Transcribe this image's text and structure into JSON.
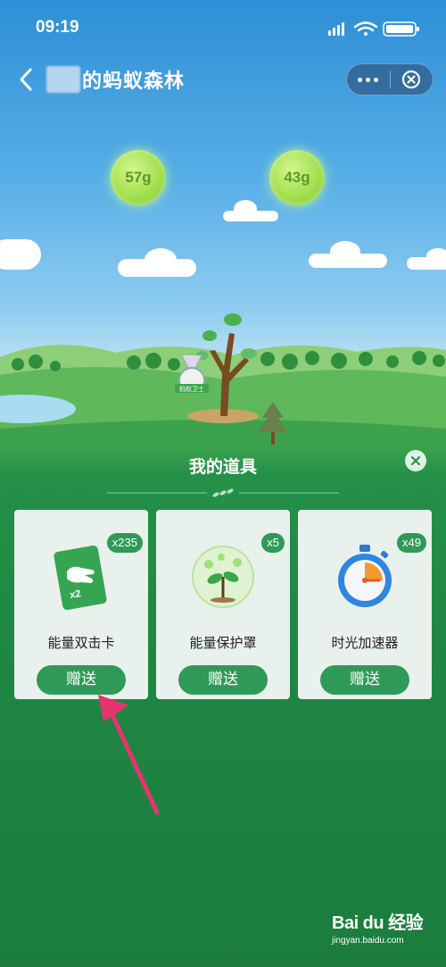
{
  "status_bar": {
    "time": "09:19"
  },
  "nav": {
    "title": "的蚂蚁森林"
  },
  "energy_balls": [
    {
      "label": "57g"
    },
    {
      "label": "43g"
    }
  ],
  "badge_text": "蚂蚁卫士",
  "tools_panel": {
    "title": "我的道具",
    "items": [
      {
        "name": "能量双击卡",
        "count": "x235",
        "button": "赠送",
        "card_text": "x2",
        "icon": "hand-double-click-card-icon"
      },
      {
        "name": "能量保护罩",
        "count": "x5",
        "button": "赠送",
        "icon": "plant-protection-shield-icon"
      },
      {
        "name": "时光加速器",
        "count": "x49",
        "button": "赠送",
        "icon": "stopwatch-icon"
      }
    ]
  },
  "watermark": {
    "logo": "Bai du 经验",
    "url": "jingyan.baidu.com"
  },
  "colors": {
    "accent_green": "#2f9a58",
    "panel_green": "#1f8744",
    "arrow_pink": "#e8336e"
  }
}
